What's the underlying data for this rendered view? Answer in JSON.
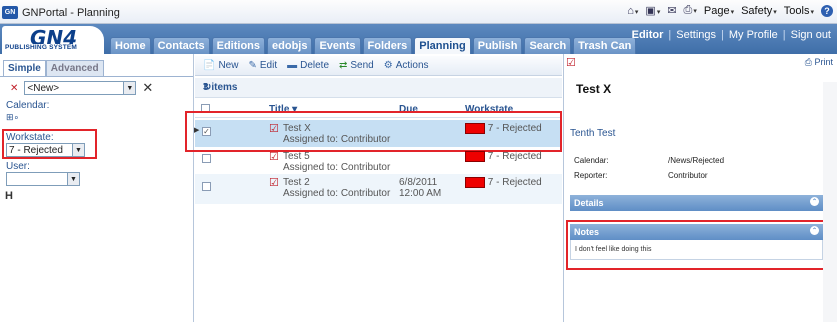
{
  "browser": {
    "tab_title": "GNPortal - Planning",
    "favicon_text": "GN",
    "menus": [
      "Page",
      "Safety",
      "Tools"
    ],
    "icons": [
      "home-icon",
      "rss-icon",
      "mail-icon",
      "print-icon",
      "help-icon"
    ]
  },
  "header": {
    "logo_main": "GN4",
    "logo_sub": "PUBLISHING SYSTEM",
    "tabs": [
      "Home",
      "Contacts",
      "Editions",
      "edobjs",
      "Events",
      "Folders",
      "Planning",
      "Publish",
      "Search",
      "Trash Can"
    ],
    "active_tab": "Planning",
    "user_links": [
      "Editor",
      "Settings",
      "My Profile",
      "Sign out"
    ]
  },
  "left": {
    "mode_tabs": [
      "Simple",
      "Advanced"
    ],
    "new_select": "<New>",
    "calendar_label": "Calendar:",
    "workstate_label": "Workstate:",
    "workstate_value": "7 - Rejected",
    "user_label": "User:",
    "user_value": ""
  },
  "center": {
    "toolbar": [
      "New",
      "Edit",
      "Delete",
      "Send",
      "Actions"
    ],
    "count": "3 items",
    "columns": {
      "title": "Title",
      "due": "Due",
      "workstate": "Workstate"
    },
    "rows": [
      {
        "title": "Test X",
        "assigned": "Assigned to: Contributor",
        "due": "",
        "due_time": "",
        "workstate": "7 - Rejected",
        "checked": true
      },
      {
        "title": "Test 5",
        "assigned": "Assigned to: Contributor",
        "due": "",
        "due_time": "",
        "workstate": "7 - Rejected",
        "checked": false
      },
      {
        "title": "Test 2",
        "assigned": "Assigned to: Contributor",
        "due": "6/8/2011",
        "due_time": "12:00 AM",
        "workstate": "7 - Rejected",
        "checked": false
      }
    ],
    "state_color": "#ee0000"
  },
  "right": {
    "print_label": "Print",
    "title": "Test X",
    "link": "Tenth Test",
    "calendar_label": "Calendar:",
    "calendar_value": "/News/Rejected",
    "reporter_label": "Reporter:",
    "reporter_value": "Contributor",
    "details_label": "Details",
    "notes_label": "Notes",
    "notes_text": "I don't feel like doing this"
  },
  "colors": {
    "highlight": "#e2242a",
    "header_blue": "#3f6ea8",
    "link_blue": "#2a5591"
  }
}
